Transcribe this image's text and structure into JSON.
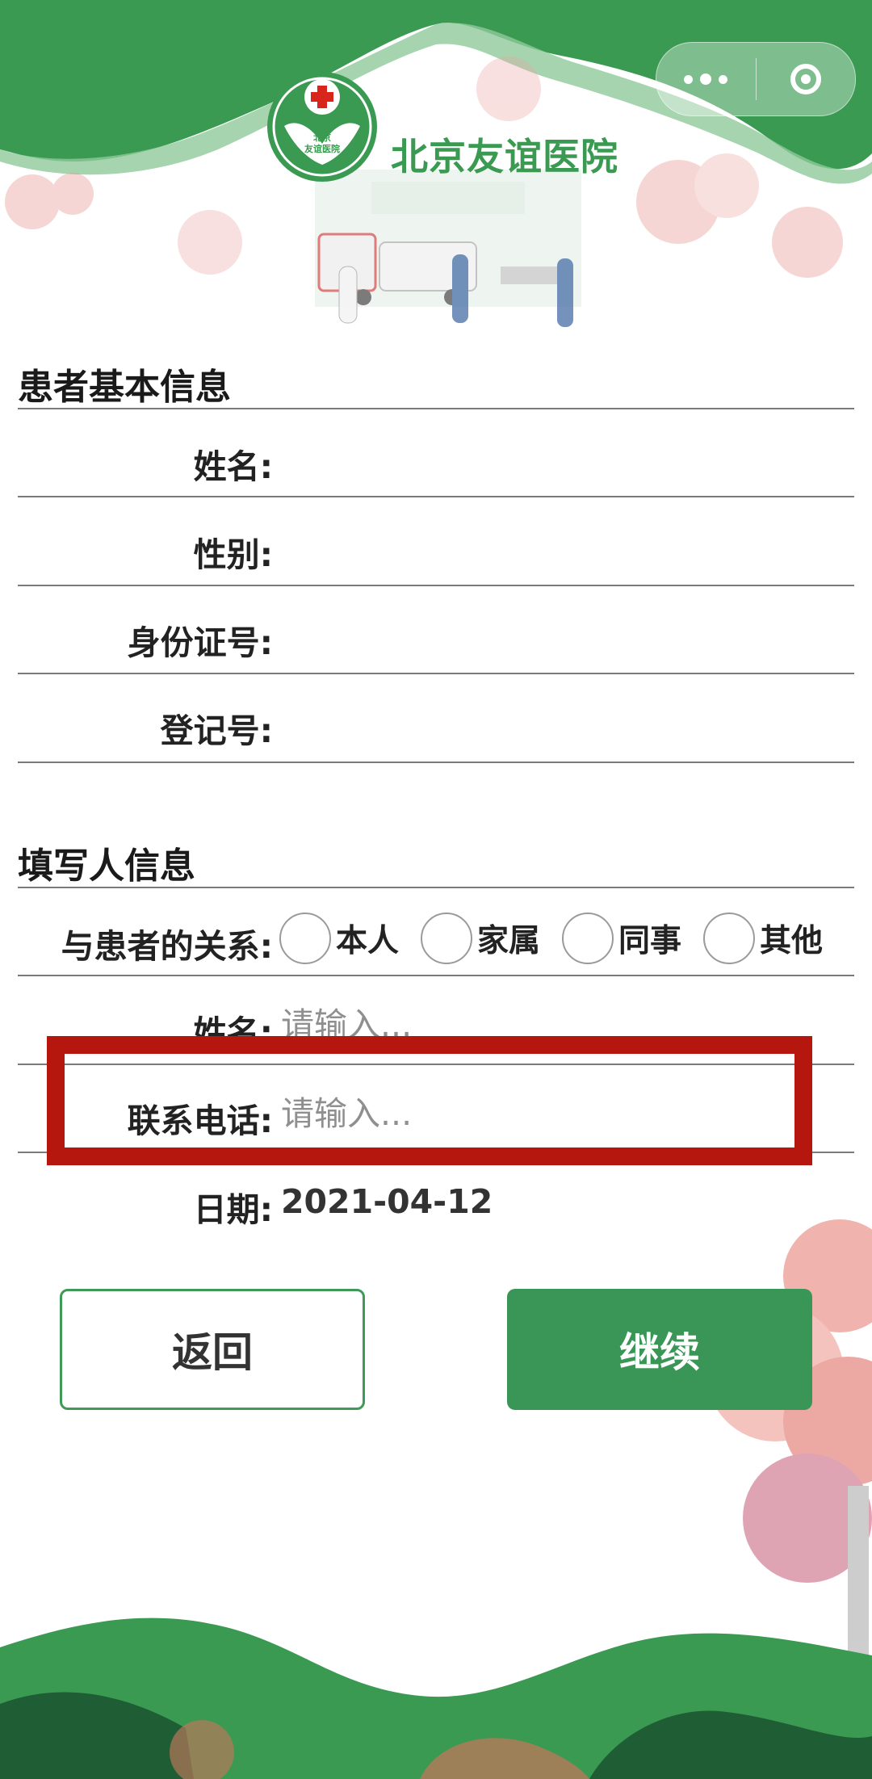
{
  "header": {
    "hospital_name": "北京友谊医院",
    "emblem_text_line1": "北京",
    "emblem_text_line2": "友谊医院"
  },
  "capsule": {
    "more_icon": "more-dots-icon",
    "close_icon": "target-circle-icon"
  },
  "patient_section": {
    "title": "患者基本信息",
    "fields": [
      {
        "label": "姓名:",
        "value": ""
      },
      {
        "label": "性别:",
        "value": ""
      },
      {
        "label": "身份证号:",
        "value": ""
      },
      {
        "label": "登记号:",
        "value": ""
      }
    ]
  },
  "filler_section": {
    "title": "填写人信息",
    "relation_label": "与患者的关系:",
    "relation_options": [
      "本人",
      "家属",
      "同事",
      "其他"
    ],
    "name_label": "姓名:",
    "name_placeholder": "请输入...",
    "phone_label": "联系电话:",
    "phone_placeholder": "请输入...",
    "date_label": "日期:",
    "date_value": "2021-04-12"
  },
  "buttons": {
    "back": "返回",
    "continue": "继续"
  },
  "colors": {
    "brand_green": "#3a9657",
    "highlight_red": "#b5160d"
  }
}
